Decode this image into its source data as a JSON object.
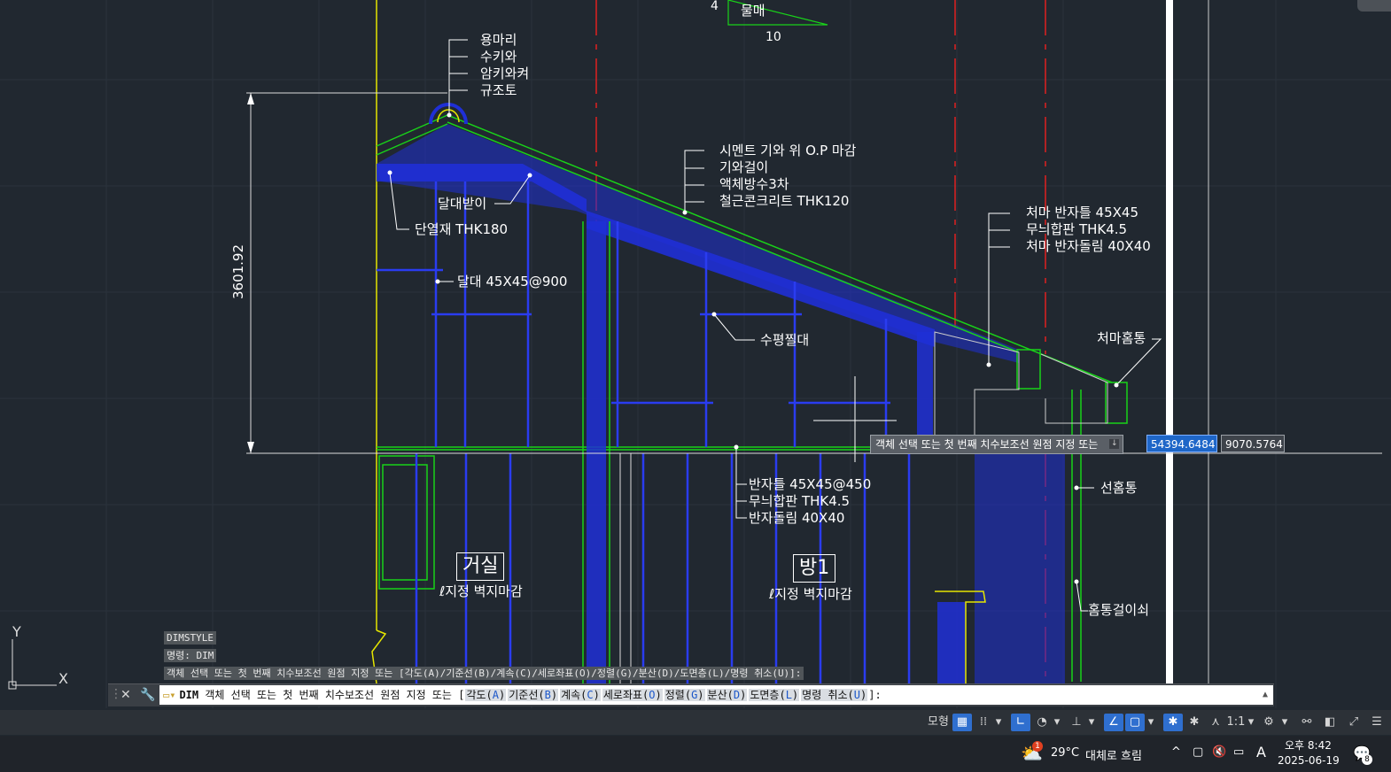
{
  "drawing": {
    "slope_label_left": "4",
    "slope_label_bottom": "10",
    "slope_label_name": "물매",
    "dimension_value": "3601.92",
    "ridge_notes": [
      "용마리",
      "수키와",
      "암키와켜",
      "규조토"
    ],
    "roof_notes": [
      "시멘트 기와 위 O.P 마감",
      "기와걸이",
      "액체방수3차",
      "철근콘크리트 THK120"
    ],
    "eave_notes": [
      "처마 반자틀 45X45",
      "무늬합판 THK4.5",
      "처마 반자돌림 40X40"
    ],
    "ceiling_notes": [
      "반자틀 45X45@450",
      "무늬합판 THK4.5",
      "반자돌림 40X40"
    ],
    "label_dalbangi": "달대받이",
    "label_insulation": "단열재 THK180",
    "label_dalde": "달대 45X45@900",
    "label_level_beam": "수평찔대",
    "label_eave_gutter": "처마홈통",
    "label_down_pipe": "선홈통",
    "label_gutter_hanger": "홈통걸이쇠",
    "rooms": [
      {
        "name": "거실",
        "note": "지정 벽지마감"
      },
      {
        "name": "방1",
        "note": "지정 벽지마감"
      }
    ]
  },
  "prompt_tooltip": "객체 선택 또는 첫 번째 치수보조선 원점 지정 또는",
  "coord_x": "54394.6484",
  "coord_y": "9070.5764",
  "ucs": {
    "y": "Y",
    "x": "X"
  },
  "command_history": [
    "DIMSTYLE",
    "명령: DIM",
    "객체 선택 또는 첫 번째 치수보조선 원점 지정 또는 [각도(A)/기준선(B)/계속(C)/세로좌표(O)/정렬(G)/분산(D)/도면층(L)/명령 취소(U)]:"
  ],
  "command_line": {
    "command": "DIM",
    "prompt": "객체 선택 또는 첫 번째 치수보조선 원점 지정 또는 [",
    "options": [
      {
        "label": "각도",
        "key": "A"
      },
      {
        "label": "기준선",
        "key": "B"
      },
      {
        "label": "계속",
        "key": "C"
      },
      {
        "label": "세로좌표",
        "key": "O"
      },
      {
        "label": "정렬",
        "key": "G"
      },
      {
        "label": "분산",
        "key": "D"
      },
      {
        "label": "도면층",
        "key": "L"
      },
      {
        "label": "명령 취소",
        "key": "U"
      }
    ],
    "suffix": "]:"
  },
  "statusbar": {
    "model_tab": "모형",
    "scale": "1:1"
  },
  "taskbar": {
    "weather_temp": "29°C",
    "weather_desc": "대체로 흐림",
    "weather_badge": "1",
    "ime": "A",
    "time": "오후 8:42",
    "date": "2025-06-19",
    "notification_count": "8"
  },
  "colors": {
    "canvas": "#212830",
    "hatch_blue": "#1f2fd6",
    "green": "#19d219",
    "red_center": "#e02020",
    "yellow": "#e6e600"
  }
}
